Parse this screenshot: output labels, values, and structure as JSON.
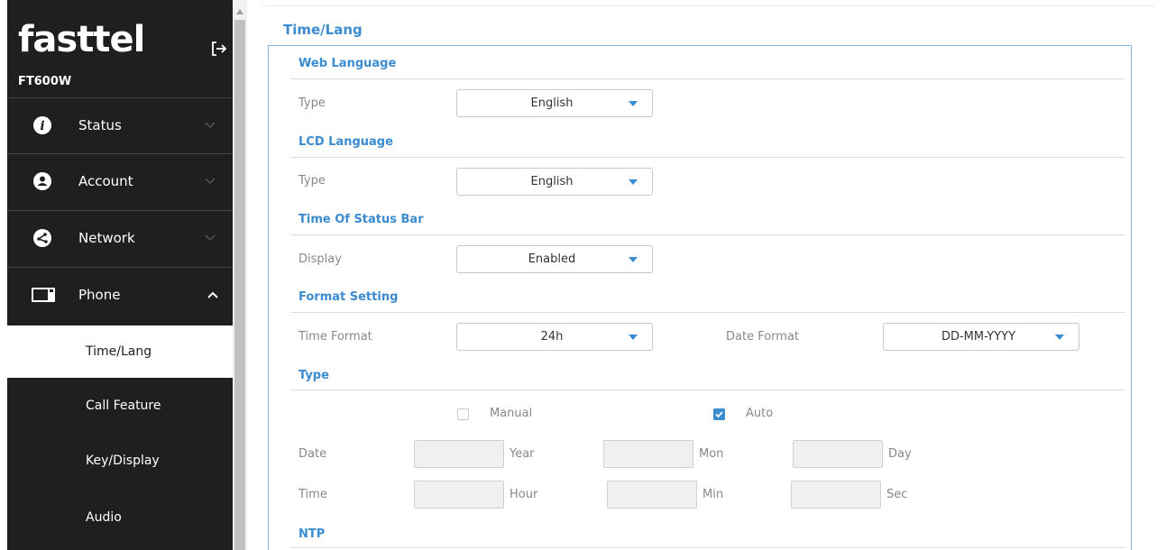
{
  "brand": {
    "logo": "fasttel",
    "model": "FT600W"
  },
  "sidebar": {
    "items": [
      {
        "label": "Status"
      },
      {
        "label": "Account"
      },
      {
        "label": "Network"
      },
      {
        "label": "Phone"
      }
    ],
    "subitems": [
      {
        "label": "Time/Lang"
      },
      {
        "label": "Call Feature"
      },
      {
        "label": "Key/Display"
      },
      {
        "label": "Audio"
      }
    ]
  },
  "page": {
    "title": "Time/Lang"
  },
  "sections": {
    "web_language": {
      "title": "Web Language",
      "type_label": "Type",
      "type_value": "English"
    },
    "lcd_language": {
      "title": "LCD Language",
      "type_label": "Type",
      "type_value": "English"
    },
    "status_bar": {
      "title": "Time Of Status Bar",
      "display_label": "Display",
      "display_value": "Enabled"
    },
    "format": {
      "title": "Format Setting",
      "time_format_label": "Time Format",
      "time_format_value": "24h",
      "date_format_label": "Date Format",
      "date_format_value": "DD-MM-YYYY"
    },
    "type": {
      "title": "Type",
      "manual_label": "Manual",
      "manual_checked": false,
      "auto_label": "Auto",
      "auto_checked": true,
      "date_label": "Date",
      "year_label": "Year",
      "mon_label": "Mon",
      "day_label": "Day",
      "time_label": "Time",
      "hour_label": "Hour",
      "min_label": "Min",
      "sec_label": "Sec"
    },
    "ntp": {
      "title": "NTP"
    }
  },
  "colors": {
    "accent": "#3a8bd0",
    "sidebar_bg": "#1f1f1f"
  }
}
